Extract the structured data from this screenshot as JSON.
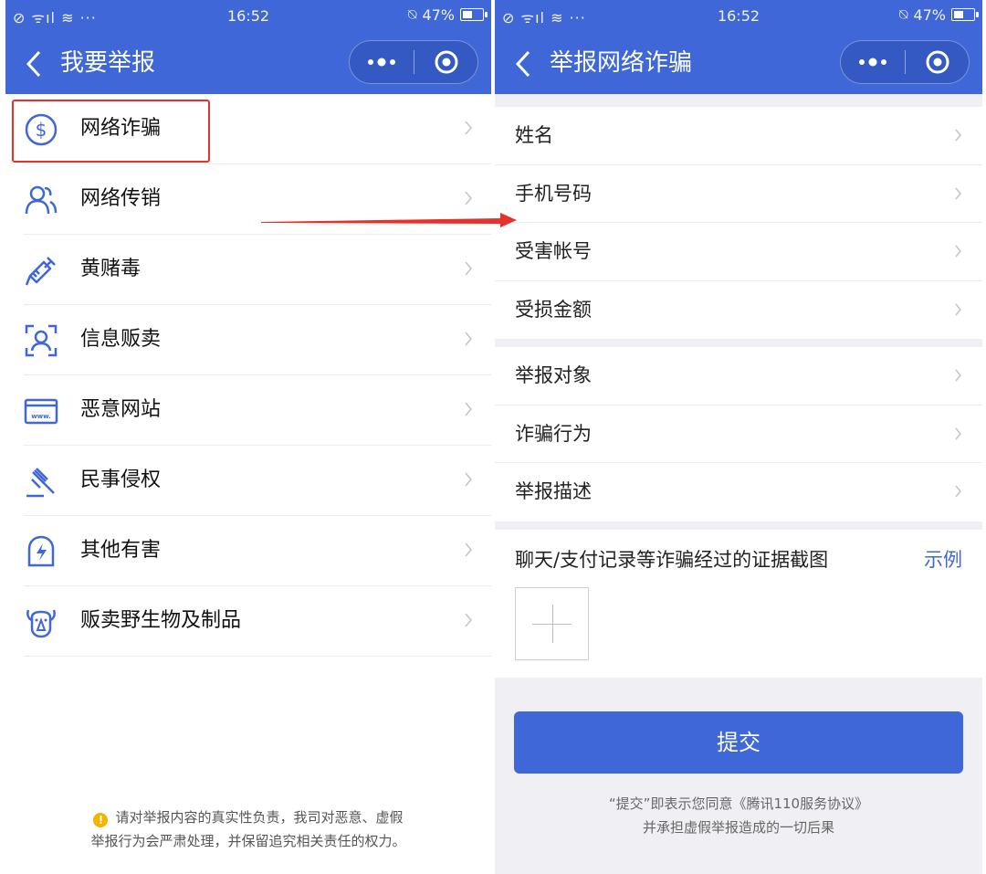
{
  "status_bar": {
    "time": "16:52",
    "battery": "47%",
    "battery_level": 0.47,
    "signal_text": "⊘ ᯤıl ≋ ···"
  },
  "left": {
    "title": "我要举报",
    "menu": [
      {
        "label": "网络诈骗",
        "icon": "dollar-circle-icon"
      },
      {
        "label": "网络传销",
        "icon": "people-icon"
      },
      {
        "label": "黄赌毒",
        "icon": "syringe-icon"
      },
      {
        "label": "信息贩卖",
        "icon": "face-scan-icon"
      },
      {
        "label": "恶意网站",
        "icon": "website-icon"
      },
      {
        "label": "民事侵权",
        "icon": "gavel-icon"
      },
      {
        "label": "其他有害",
        "icon": "lightning-shield-icon"
      },
      {
        "label": "贩卖野生物及制品",
        "icon": "animal-icon"
      }
    ],
    "notice_line1": "请对举报内容的真实性负责，我司对恶意、虚假",
    "notice_line2": "举报行为会严肃处理，并保留追究相关责任的权力。",
    "notice_icon": "!"
  },
  "right": {
    "title": "举报网络诈骗",
    "group1": [
      {
        "label": "姓名"
      },
      {
        "label": "手机号码"
      },
      {
        "label": "受害帐号"
      },
      {
        "label": "受损金额"
      }
    ],
    "group2": [
      {
        "label": "举报对象"
      },
      {
        "label": "诈骗行为"
      },
      {
        "label": "举报描述"
      }
    ],
    "evidence_label": "聊天/支付记录等诈骗经过的证据截图",
    "example_link": "示例",
    "submit_label": "提交",
    "agree_line1": "“提交”即表示您同意《腾讯110服务协议》",
    "agree_line2": "并承担虚假举报造成的一切后果"
  },
  "colors": {
    "primary": "#3f67d8",
    "highlight": "#e5322d",
    "arrow": "#e5322d",
    "warning": "#f5b300"
  }
}
